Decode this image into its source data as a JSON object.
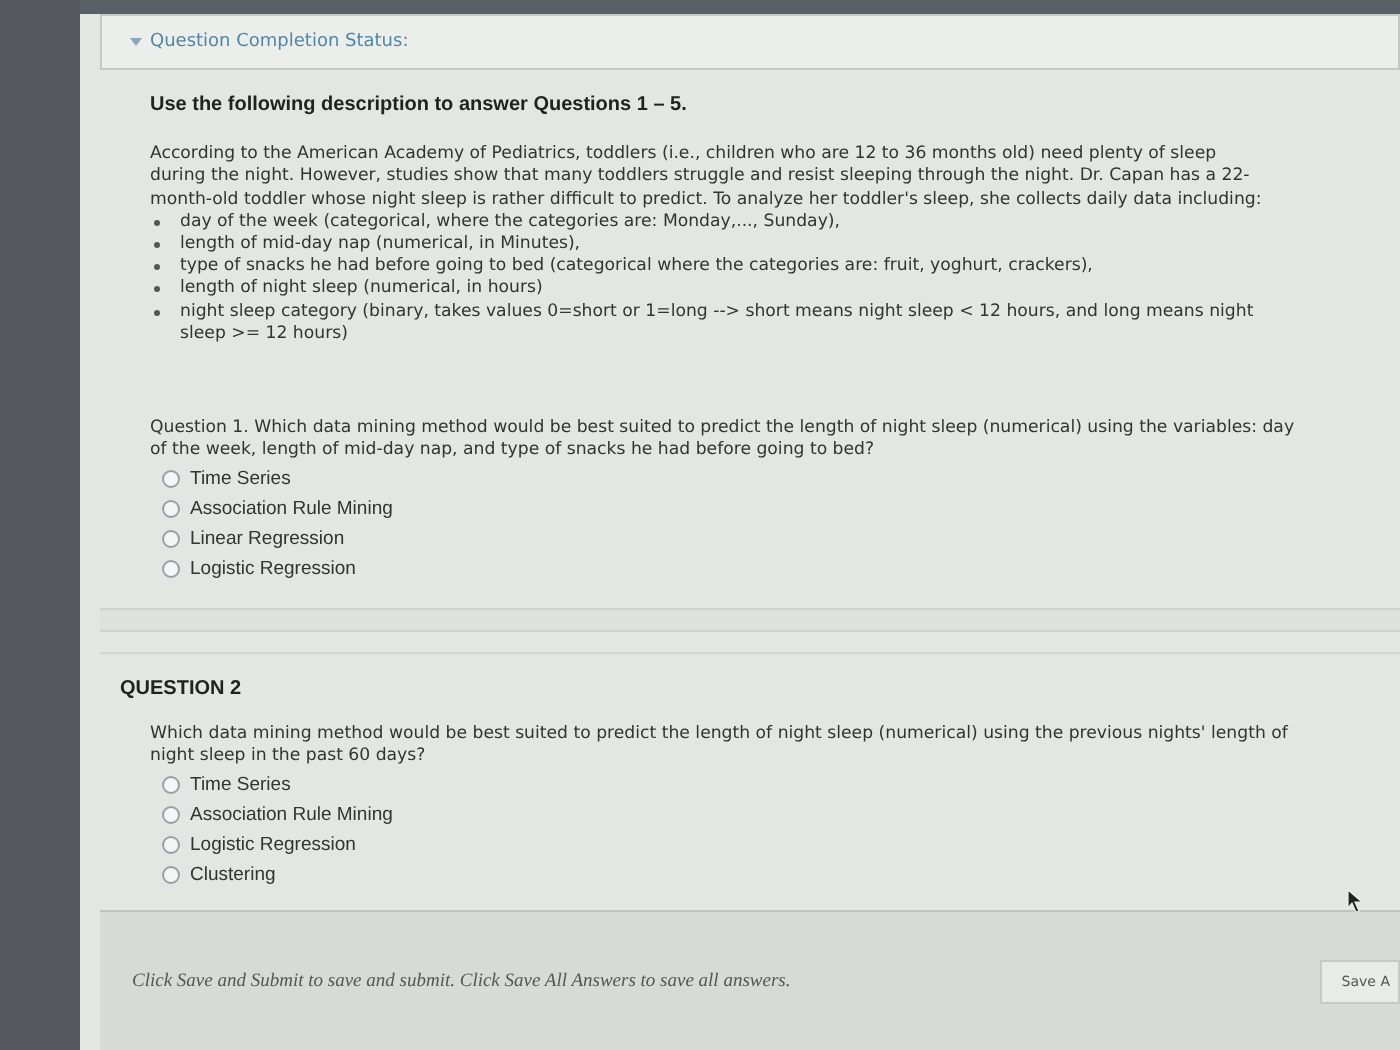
{
  "status_header": {
    "label": "Question Completion Status:",
    "expanded": true
  },
  "description": {
    "heading": "Use the following description to answer Questions 1 – 5.",
    "intro": "According to the American Academy of Pediatrics, toddlers (i.e., children who are 12 to 36 months old) need plenty of sleep during the night. However, studies show that many toddlers struggle and resist sleeping through the night. Dr. Capan has a 22-month-old toddler whose night sleep is rather difficult to predict. To analyze her toddler's sleep, she collects daily data including:",
    "bullets": [
      "day of the week (categorical, where the categories are: Monday,..., Sunday),",
      "length of mid-day nap (numerical, in Minutes),",
      "type of snacks he had before going to bed (categorical where the categories are: fruit, yoghurt, crackers),",
      "length of night sleep (numerical, in hours)",
      "night sleep category (binary, takes values 0=short or 1=long --> short means night sleep < 12 hours, and long means night sleep >= 12 hours)"
    ]
  },
  "questions": [
    {
      "text": "Question 1. Which data mining method would be best suited to predict the length of night sleep (numerical) using the variables: day of the week, length of mid-day nap, and type of snacks he had before going to bed?",
      "options": [
        {
          "label": "Time Series",
          "selected": false
        },
        {
          "label": "Association Rule Mining",
          "selected": false
        },
        {
          "label": "Linear Regression",
          "selected": false
        },
        {
          "label": "Logistic Regression",
          "selected": false
        }
      ]
    },
    {
      "title": "QUESTION 2",
      "text": "Which data mining method would be best suited to predict the length of night sleep (numerical) using the previous nights' length of night sleep in the past 60 days?",
      "options": [
        {
          "label": "Time Series",
          "selected": false
        },
        {
          "label": "Association Rule Mining",
          "selected": false
        },
        {
          "label": "Logistic Regression",
          "selected": false
        },
        {
          "label": "Clustering",
          "selected": false
        }
      ]
    }
  ],
  "footer": {
    "instructions": "Click Save and Submit to save and submit. Click Save All Answers to save all answers.",
    "button": "Save A"
  }
}
